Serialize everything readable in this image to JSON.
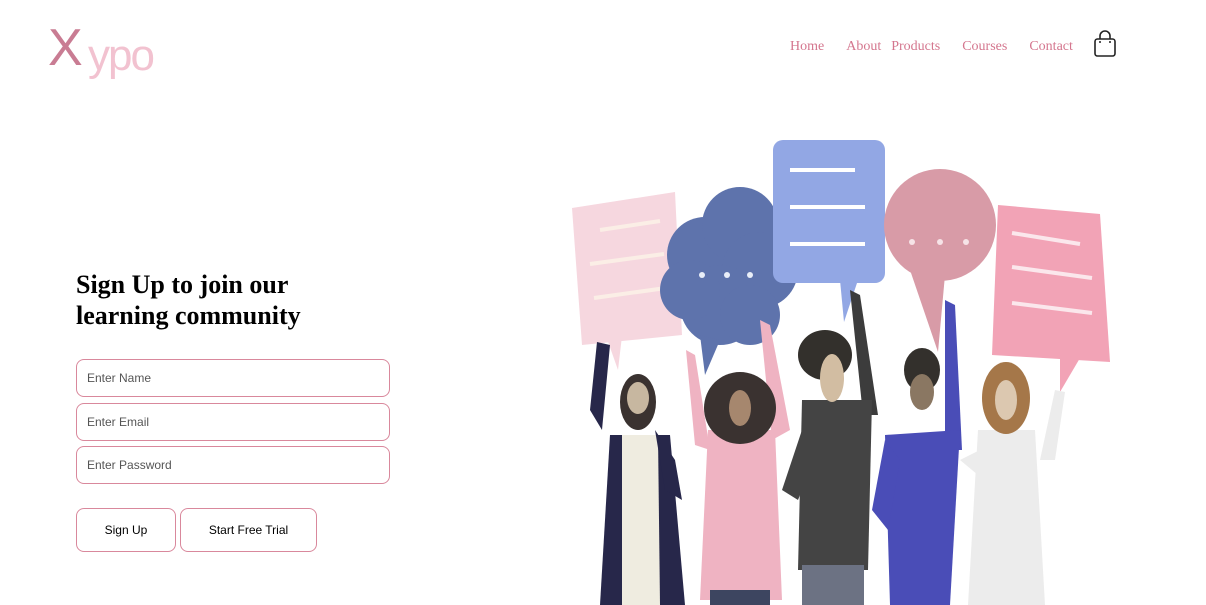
{
  "brand": {
    "logo_first": "X",
    "logo_rest": "ypo"
  },
  "nav": {
    "items": [
      {
        "label": "Home"
      },
      {
        "label": "About"
      },
      {
        "label": "Products"
      },
      {
        "label": "Courses"
      },
      {
        "label": "Contact"
      }
    ],
    "cart_icon": "shopping-bag-icon"
  },
  "signup": {
    "heading_line1": "Sign Up to join our",
    "heading_line2": "learning community",
    "name_placeholder": "Enter Name",
    "email_placeholder": "Enter Email",
    "password_placeholder": "Enter Password",
    "signup_label": "Sign Up",
    "trial_label": "Start Free Trial"
  },
  "colors": {
    "accent": "#d4768e",
    "logo_dark": "#c97c93",
    "logo_light": "#f2c2d0",
    "field_border": "#d9889c"
  }
}
